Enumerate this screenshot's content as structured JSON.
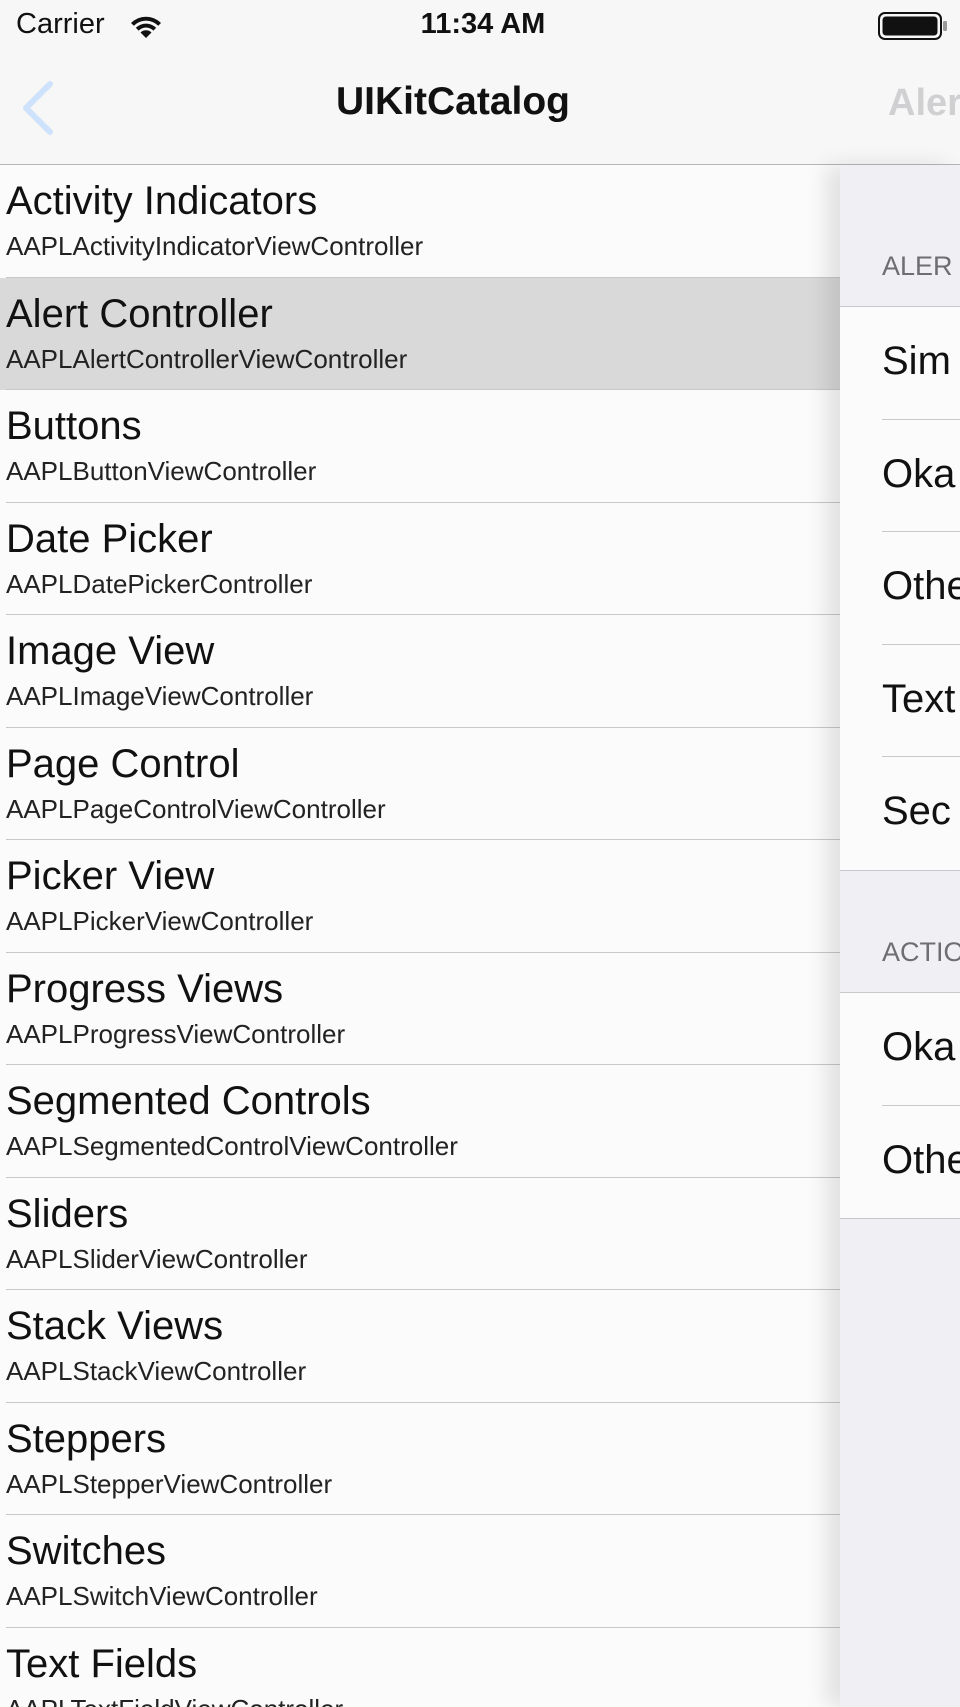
{
  "status_bar": {
    "carrier": "Carrier",
    "time": "11:34 AM"
  },
  "nav_bar": {
    "title": "UIKitCatalog",
    "detail_title_peek": "Aler"
  },
  "master_list": {
    "selected_index": 1,
    "items": [
      {
        "title": "Activity Indicators",
        "subtitle": "AAPLActivityIndicatorViewController"
      },
      {
        "title": "Alert Controller",
        "subtitle": "AAPLAlertControllerViewController"
      },
      {
        "title": "Buttons",
        "subtitle": "AAPLButtonViewController"
      },
      {
        "title": "Date Picker",
        "subtitle": "AAPLDatePickerController"
      },
      {
        "title": "Image View",
        "subtitle": "AAPLImageViewController"
      },
      {
        "title": "Page Control",
        "subtitle": "AAPLPageControlViewController"
      },
      {
        "title": "Picker View",
        "subtitle": "AAPLPickerViewController"
      },
      {
        "title": "Progress Views",
        "subtitle": "AAPLProgressViewController"
      },
      {
        "title": "Segmented Controls",
        "subtitle": "AAPLSegmentedControlViewController"
      },
      {
        "title": "Sliders",
        "subtitle": "AAPLSliderViewController"
      },
      {
        "title": "Stack Views",
        "subtitle": "AAPLStackViewController"
      },
      {
        "title": "Steppers",
        "subtitle": "AAPLStepperViewController"
      },
      {
        "title": "Switches",
        "subtitle": "AAPLSwitchViewController"
      },
      {
        "title": "Text Fields",
        "subtitle": "AAPLTextFieldViewController"
      }
    ]
  },
  "detail_pane": {
    "alert_section": {
      "header": "ALER",
      "rows": [
        "Sim",
        "Oka",
        "Othe",
        "Text",
        "Sec"
      ]
    },
    "action_section": {
      "header": "ACTIO",
      "rows": [
        "Oka",
        "Othe"
      ]
    }
  },
  "icons": {
    "wifi": "wifi-icon",
    "battery": "battery-icon",
    "back": "chevron-left-icon"
  },
  "colors": {
    "accent": "#007aff",
    "selected_row": "#d9d9d9",
    "grouped_background": "#efeff4",
    "section_header_text": "#6d6d72"
  }
}
